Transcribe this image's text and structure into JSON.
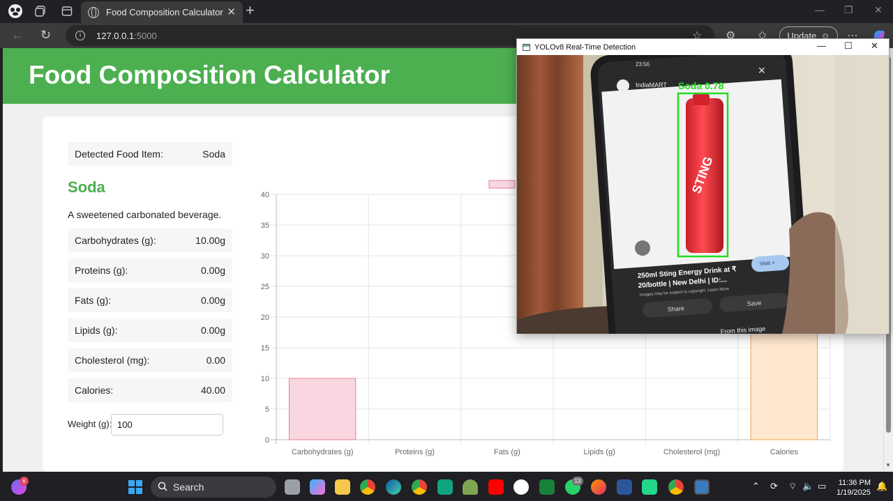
{
  "browser": {
    "tab_title": "Food Composition Calculator",
    "url_host": "127.0.0.1",
    "url_port": ":5000",
    "update_label": "Update"
  },
  "page": {
    "title": "Food Composition Calculator",
    "detected_label": "Detected Food Item:",
    "detected_value": "Soda",
    "food_name": "Soda",
    "description": "A sweetened carbonated beverage.",
    "nutrients": [
      {
        "label": "Carbohydrates (g):",
        "value": "10.00g"
      },
      {
        "label": "Proteins (g):",
        "value": "0.00g"
      },
      {
        "label": "Fats (g):",
        "value": "0.00g"
      },
      {
        "label": "Lipids (g):",
        "value": "0.00g"
      },
      {
        "label": "Cholesterol (mg):",
        "value": "0.00"
      },
      {
        "label": "Calories:",
        "value": "40.00"
      }
    ],
    "weight_label": "Weight (g):",
    "weight_value": "100"
  },
  "chart_data": {
    "type": "bar",
    "categories": [
      "Carbohydrates (g)",
      "Proteins (g)",
      "Fats (g)",
      "Lipids (g)",
      "Cholesterol (mg)",
      "Calories"
    ],
    "values": [
      10,
      0,
      0,
      0,
      0,
      40
    ],
    "ylim": [
      0,
      40
    ],
    "yticks": [
      0,
      5,
      10,
      15,
      20,
      25,
      30,
      35,
      40
    ],
    "bar_colors": [
      "#f8d7e0",
      "#d5ecf7",
      "#fff1cc",
      "#d8f0ef",
      "#e6dcff",
      "#ffe8cf"
    ],
    "bar_borders": [
      "#ec7a94",
      "#5aa9e0",
      "#f5c24c",
      "#5cbcbc",
      "#9966ff",
      "#f6a34b"
    ],
    "grid": true,
    "legend": "top"
  },
  "detection_window": {
    "title": "YOLOv8 Real-Time Detection",
    "label": "Soda 0.78",
    "phone_app": "IndiaMART",
    "phone_time": "23:56",
    "caption_line1": "250ml Sting Energy Drink at ₹",
    "caption_line2": "20/bottle | New Delhi | ID:...",
    "caption_small": "Images may be subject to copyright. Learn More",
    "visit_label": "Visit >",
    "share_label": "Share",
    "save_label": "Save",
    "bottom_text": "From this image"
  },
  "taskbar": {
    "search_label": "Search",
    "time": "11:36 PM",
    "date": "1/19/2025",
    "copilot_badge": "6",
    "whatsapp_badge": "13"
  },
  "colors": {
    "header_green": "#4caf50",
    "detection_box": "#22dd22"
  }
}
